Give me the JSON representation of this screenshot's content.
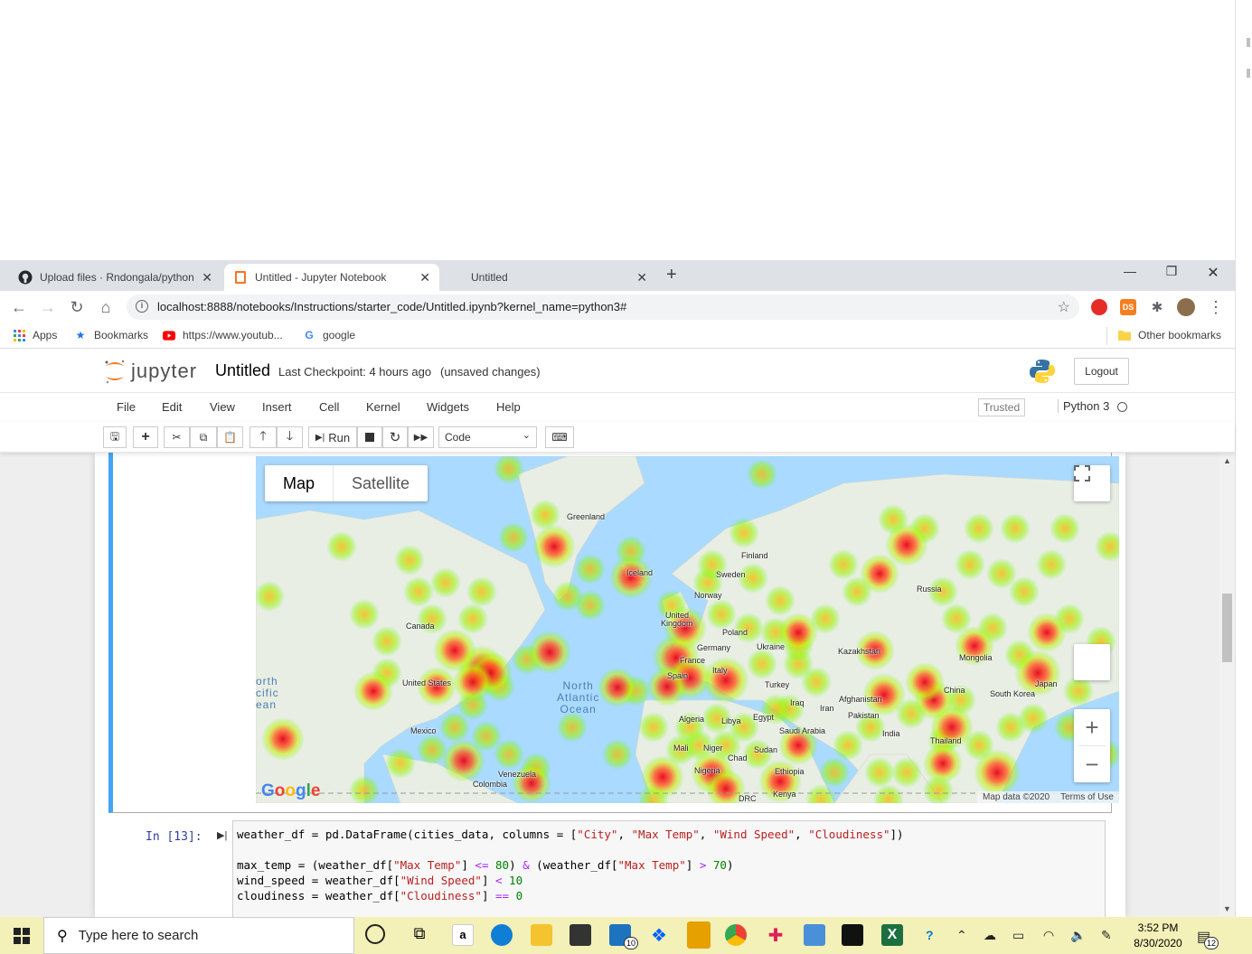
{
  "browser": {
    "tabs": [
      {
        "title": "Upload files · Rndongala/python-"
      },
      {
        "title": "Untitled - Jupyter Notebook"
      },
      {
        "title": "Untitled"
      }
    ],
    "url": "localhost:8888/notebooks/Instructions/starter_code/Untitled.ipynb?kernel_name=python3#",
    "bookmarks": [
      "Apps",
      "Bookmarks",
      "https://www.youtub...",
      "google"
    ],
    "other_bookmarks": "Other bookmarks",
    "ext_ds": "DS"
  },
  "jupyter": {
    "logo_text": "jupyter",
    "title": "Untitled",
    "checkpoint": "Last Checkpoint: 4 hours ago",
    "unsaved": "(unsaved changes)",
    "logout": "Logout",
    "menu": [
      "File",
      "Edit",
      "View",
      "Insert",
      "Cell",
      "Kernel",
      "Widgets",
      "Help"
    ],
    "trusted": "Trusted",
    "kernel": "Python 3",
    "run_label": "Run",
    "cell_type": "Code"
  },
  "map": {
    "type_map": "Map",
    "type_satellite": "Satellite",
    "attribution": "Map data ©2020",
    "terms": "Terms of Use",
    "google": "Google",
    "labels": {
      "greenland": "Greenland",
      "iceland": "Iceland",
      "finland": "Finland",
      "sweden": "Sweden",
      "norway": "Norway",
      "uk1": "United",
      "uk2": "Kingdom",
      "poland": "Poland",
      "germany": "Germany",
      "ukraine": "Ukraine",
      "france": "France",
      "italy": "Italy",
      "spain": "Spain",
      "russia": "Russia",
      "kazakhstan": "Kazakhstan",
      "mongolia": "Mongolia",
      "china": "China",
      "south_korea": "South Korea",
      "japan": "Japan",
      "turkey": "Turkey",
      "iraq": "Iraq",
      "iran": "Iran",
      "afghanistan": "Afghanistan",
      "pakistan": "Pakistan",
      "india": "India",
      "thailand": "Thailand",
      "saudi": "Saudi Arabia",
      "egypt": "Egypt",
      "libya": "Libya",
      "algeria": "Algeria",
      "mali": "Mali",
      "niger": "Niger",
      "chad": "Chad",
      "sudan": "Sudan",
      "nigeria": "Nigeria",
      "ethiopia": "Ethiopia",
      "kenya": "Kenya",
      "drc": "DRC",
      "canada": "Canada",
      "usa": "United States",
      "mexico": "Mexico",
      "venezuela": "Venezuela",
      "colombia": "Colombia",
      "north_atlantic": "North\nAtlantic\nOcean",
      "north_pacific": "orth\ncific\nean"
    }
  },
  "cell": {
    "prompt": "In [13]:",
    "code": {
      "l1_a": "weather_df = pd.DataFrame(cities_data, columns = [",
      "l1_s1": "\"City\"",
      "l1_s2": "\"Max Temp\"",
      "l1_s3": "\"Wind Speed\"",
      "l1_s4": "\"Cloudiness\"",
      "l3_a": "max_temp = (weather_df[",
      "l3_s1": "\"Max Temp\"",
      "l3_b": "] ",
      "l3_op1": "<=",
      "l3_n1": " 80",
      "l3_c": ") ",
      "l3_op2": "&",
      "l3_d": " (weather_df[",
      "l3_s2": "\"Max Temp\"",
      "l3_e": "] ",
      "l3_op3": ">",
      "l3_n2": " 70",
      "l3_f": ")",
      "l4_a": "wind_speed = weather_df[",
      "l4_s1": "\"Wind Speed\"",
      "l4_b": "] ",
      "l4_op": "<",
      "l4_n": " 10",
      "l5_a": "cloudiness = weather_df[",
      "l5_s1": "\"Cloudiness\"",
      "l5_b": "] ",
      "l5_op": "==",
      "l5_n": " 0"
    }
  },
  "taskbar": {
    "search": "Type here to search",
    "time": "3:52 PM",
    "date": "8/30/2020",
    "mail_badge": "10",
    "notif_badge": "12"
  }
}
